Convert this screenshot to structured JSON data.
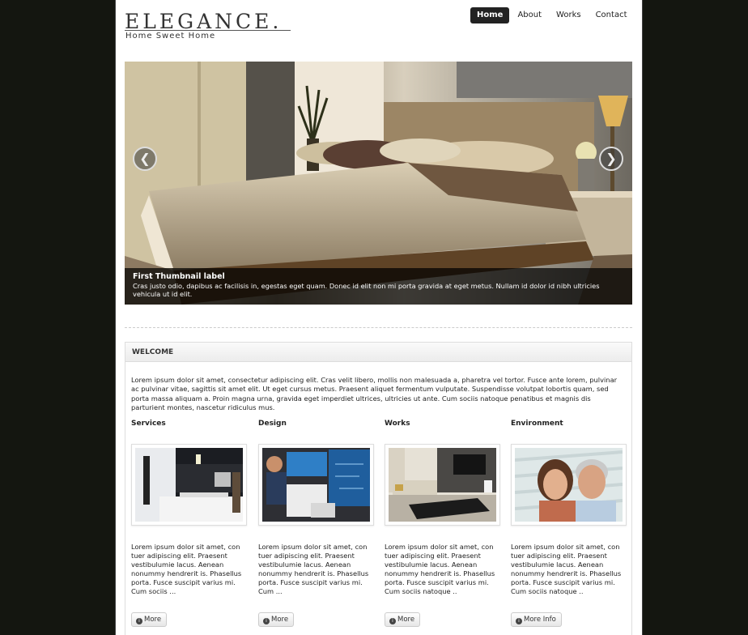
{
  "brand": {
    "logo": "ELEGANCE.",
    "tagline": "Home Sweet Home"
  },
  "nav": [
    "Home",
    "About",
    "Works",
    "Contact"
  ],
  "carousel": {
    "caption_title": "First Thumbnail label",
    "caption_text": "Cras justo odio, dapibus ac facilisis in, egestas eget quam. Donec id elit non mi porta gravida at eget metus. Nullam id dolor id nibh ultricies vehicula ut id elit.",
    "prev_icon": "chevron-left-icon",
    "next_icon": "chevron-right-icon"
  },
  "welcome": {
    "heading": "WELCOME",
    "intro": "Lorem ipsum dolor sit amet, consectetur adipiscing elit. Cras velit libero, mollis non malesuada a, pharetra vel tortor. Fusce ante lorem, pulvinar ac pulvinar vitae, sagittis sit amet elit. Ut eget cursus metus. Praesent aliquet fermentum vulputate. Suspendisse volutpat lobortis quam, sed porta massa aliquam a. Proin magna urna, gravida eget imperdiet ultrices, ultricies ut ante. Cum sociis natoque penatibus et magnis dis parturient montes, nascetur ridiculus mus."
  },
  "columns": [
    {
      "title": "Services",
      "text": "Lorem ipsum dolor sit amet, con tuer adipiscing elit. Praesent vestibulumie lacus. Aenean nonummy hendrerit is. Phasellus porta. Fusce suscipit varius mi. Cum sociis ...",
      "button": "More"
    },
    {
      "title": "Design",
      "text": "Lorem ipsum dolor sit amet, con tuer adipiscing elit. Praesent vestibulumie lacus. Aenean nonummy hendrerit is. Phasellus porta. Fusce suscipit varius mi. Cum ...",
      "button": "More"
    },
    {
      "title": "Works",
      "text": "Lorem ipsum dolor sit amet, con tuer adipiscing elit. Praesent vestibulumie lacus. Aenean nonummy hendrerit is. Phasellus porta. Fusce suscipit varius mi. Cum sociis natoque ..",
      "button": "More"
    },
    {
      "title": "Environment",
      "text": "Lorem ipsum dolor sit amet, con tuer adipiscing elit. Praesent vestibulumie lacus. Aenean nonummy hendrerit is. Phasellus porta. Fusce suscipit varius mi. Cum sociis natoque ..",
      "button": "More Info"
    }
  ],
  "colors": {
    "background": "#141610",
    "nav_active": "#222222",
    "caption_bg": "#000000"
  }
}
